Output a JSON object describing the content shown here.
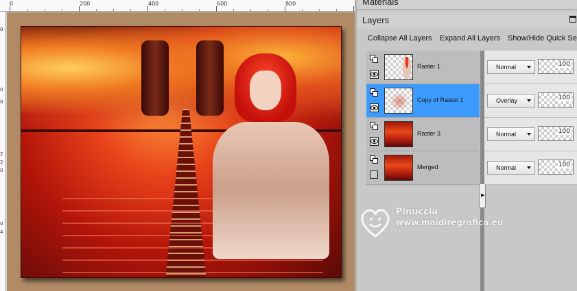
{
  "ruler": {
    "labels": [
      "0",
      "200",
      "400",
      "600",
      "800"
    ]
  },
  "ruler_left": {
    "labels": [
      "0",
      "0",
      "0",
      "2",
      "2",
      "0",
      "0",
      "4"
    ]
  },
  "panels": {
    "materials": {
      "title": "Materials"
    },
    "layers": {
      "title": "Layers",
      "toolbar": {
        "collapse_label": "Collapse All Layers",
        "expand_label": "Expand All Layers",
        "showhide_label": "Show/Hide Quick Se"
      },
      "rows": [
        {
          "name": "Raster 1",
          "blend": "Normal",
          "opacity": "100",
          "selected": false,
          "visible": true
        },
        {
          "name": "Copy of Raster 1",
          "blend": "Overlay",
          "opacity": "100",
          "selected": true,
          "visible": true
        },
        {
          "name": "Raster 3",
          "blend": "Normal",
          "opacity": "100",
          "selected": false,
          "visible": true
        },
        {
          "name": "Merged",
          "blend": "Normal",
          "opacity": "100",
          "selected": false,
          "visible": false
        }
      ]
    }
  },
  "watermark": {
    "name": "Pinuccia",
    "url": "www.maidiregrafica.eu"
  },
  "colors": {
    "selection": "#3d9bff",
    "panel_bg": "#c8c8c8"
  },
  "icons": [
    "layer-group-icon",
    "eye-icon",
    "visibility-box-icon",
    "dropdown-caret-icon",
    "panel-close-icon",
    "scroll-right-arrow-icon",
    "heart-smiley-watermark-icon"
  ]
}
